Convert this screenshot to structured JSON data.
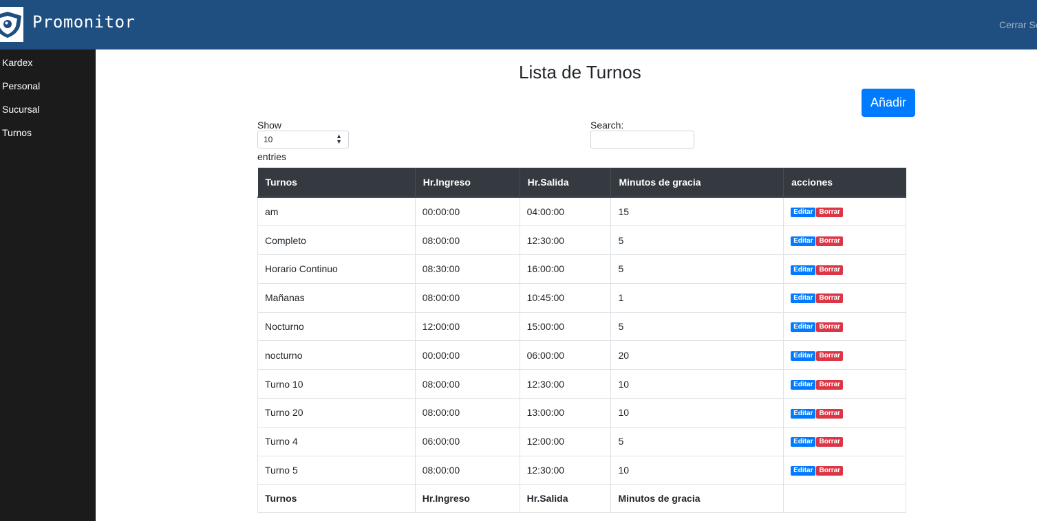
{
  "header": {
    "brand": "Promonitor",
    "logout": "Cerrar Sesión"
  },
  "sidebar": {
    "items": [
      {
        "label": "Kardex"
      },
      {
        "label": "Personal"
      },
      {
        "label": "Sucursal"
      },
      {
        "label": "Turnos"
      }
    ]
  },
  "main": {
    "title": "Lista de Turnos",
    "add_label": "Añadir",
    "show_label": "Show",
    "entries_value": "10",
    "entries_label": "entries",
    "search_label": "Search:",
    "search_value": "",
    "table": {
      "headers": [
        "Turnos",
        "Hr.Ingreso",
        "Hr.Salida",
        "Minutos de gracia",
        "acciones"
      ],
      "rows": [
        {
          "turno": "am",
          "ingreso": "00:00:00",
          "salida": "04:00:00",
          "gracia": "15"
        },
        {
          "turno": "Completo",
          "ingreso": "08:00:00",
          "salida": "12:30:00",
          "gracia": "5"
        },
        {
          "turno": "Horario Continuo",
          "ingreso": "08:30:00",
          "salida": "16:00:00",
          "gracia": "5"
        },
        {
          "turno": "Mañanas",
          "ingreso": "08:00:00",
          "salida": "10:45:00",
          "gracia": "1"
        },
        {
          "turno": "Nocturno",
          "ingreso": "12:00:00",
          "salida": "15:00:00",
          "gracia": "5"
        },
        {
          "turno": "nocturno",
          "ingreso": "00:00:00",
          "salida": "06:00:00",
          "gracia": "20"
        },
        {
          "turno": "Turno 10",
          "ingreso": "08:00:00",
          "salida": "12:30:00",
          "gracia": "10"
        },
        {
          "turno": "Turno 20",
          "ingreso": "08:00:00",
          "salida": "13:00:00",
          "gracia": "10"
        },
        {
          "turno": "Turno 4",
          "ingreso": "06:00:00",
          "salida": "12:00:00",
          "gracia": "5"
        },
        {
          "turno": "Turno 5",
          "ingreso": "08:00:00",
          "salida": "12:30:00",
          "gracia": "10"
        }
      ],
      "footer": [
        "Turnos",
        "Hr.Ingreso",
        "Hr.Salida",
        "Minutos de gracia",
        ""
      ],
      "edit_label": "Editar",
      "delete_label": "Borrar"
    }
  },
  "colors": {
    "navbar": "#1f4e80",
    "sidebar": "#1b1b1b",
    "primary": "#007bff",
    "danger": "#dc3545",
    "table_head": "#343a40"
  },
  "icons": {
    "logo": "shield-eye-icon",
    "select_arrows": "sort-arrows-icon"
  }
}
